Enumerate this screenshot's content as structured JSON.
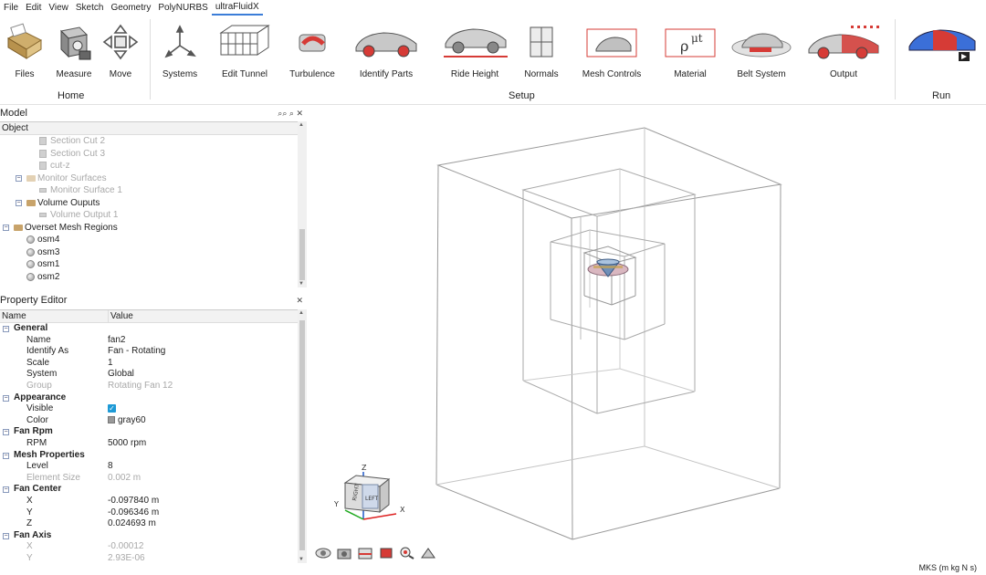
{
  "menu": [
    "File",
    "Edit",
    "View",
    "Sketch",
    "Geometry",
    "PolyNURBS",
    "ultraFluidX"
  ],
  "ribbon": {
    "files": "Files",
    "measure": "Measure",
    "move": "Move",
    "systems": "Systems",
    "edit_tunnel": "Edit Tunnel",
    "turbulence": "Turbulence",
    "identify_parts": "Identify Parts",
    "ride_height": "Ride Height",
    "normals": "Normals",
    "mesh_controls": "Mesh Controls",
    "material": "Material",
    "belt_system": "Belt System",
    "output": "Output",
    "groups": {
      "home": "Home",
      "setup": "Setup",
      "run": "Run"
    }
  },
  "model_panel": {
    "title": "Model",
    "column": "Object",
    "rows": [
      "Section Cut 2",
      "Section Cut 3",
      "cut-z",
      "Monitor Surfaces",
      "Monitor Surface 1",
      "Volume Ouputs",
      "Volume Output 1",
      "Overset Mesh Regions",
      "osm4",
      "osm3",
      "osm1",
      "osm2"
    ]
  },
  "property_editor": {
    "title": "Property Editor",
    "columns": {
      "name": "Name",
      "value": "Value"
    },
    "sections": {
      "general": "General",
      "appearance": "Appearance",
      "fan_rpm": "Fan Rpm",
      "mesh_properties": "Mesh Properties",
      "fan_center": "Fan Center",
      "fan_axis": "Fan Axis"
    },
    "props": {
      "name": {
        "k": "Name",
        "v": "fan2"
      },
      "identify_as": {
        "k": "Identify As",
        "v": "Fan - Rotating"
      },
      "scale": {
        "k": "Scale",
        "v": "1"
      },
      "system": {
        "k": "System",
        "v": "Global"
      },
      "group": {
        "k": "Group",
        "v": "Rotating Fan 12"
      },
      "visible": {
        "k": "Visible",
        "v": true
      },
      "color": {
        "k": "Color",
        "v": "gray60"
      },
      "rpm": {
        "k": "RPM",
        "v": "5000 rpm"
      },
      "level": {
        "k": "Level",
        "v": "8"
      },
      "element_size": {
        "k": "Element Size",
        "v": "0.002 m"
      },
      "center_x": {
        "k": "X",
        "v": "-0.097840 m"
      },
      "center_y": {
        "k": "Y",
        "v": "-0.096346 m"
      },
      "center_z": {
        "k": "Z",
        "v": "0.024693 m"
      },
      "axis_x": {
        "k": "X",
        "v": "-0.00012"
      },
      "axis_y": {
        "k": "Y",
        "v": "2.93E-06"
      }
    }
  },
  "viewport": {
    "units": "MKS (m kg N s)",
    "axes": {
      "x": "X",
      "y": "Y",
      "z": "Z"
    },
    "cube_faces": {
      "left": "LEFT",
      "right": "RIGHT"
    }
  },
  "icons": {
    "files": "folder-icon",
    "measure": "measure-icon",
    "move": "move-icon",
    "systems": "axes-icon",
    "edit_tunnel": "tunnel-icon",
    "turbulence": "turbulence-icon",
    "identify_parts": "car-parts-icon",
    "ride_height": "ride-height-icon",
    "normals": "normals-icon",
    "mesh_controls": "mesh-controls-icon",
    "material": "material-icon",
    "belt_system": "belt-system-icon",
    "output": "output-icon",
    "run": "run-icon"
  },
  "colors": {
    "accent": "#3b7dd8",
    "car_red": "#d63b36",
    "check": "#1e9ad6"
  }
}
